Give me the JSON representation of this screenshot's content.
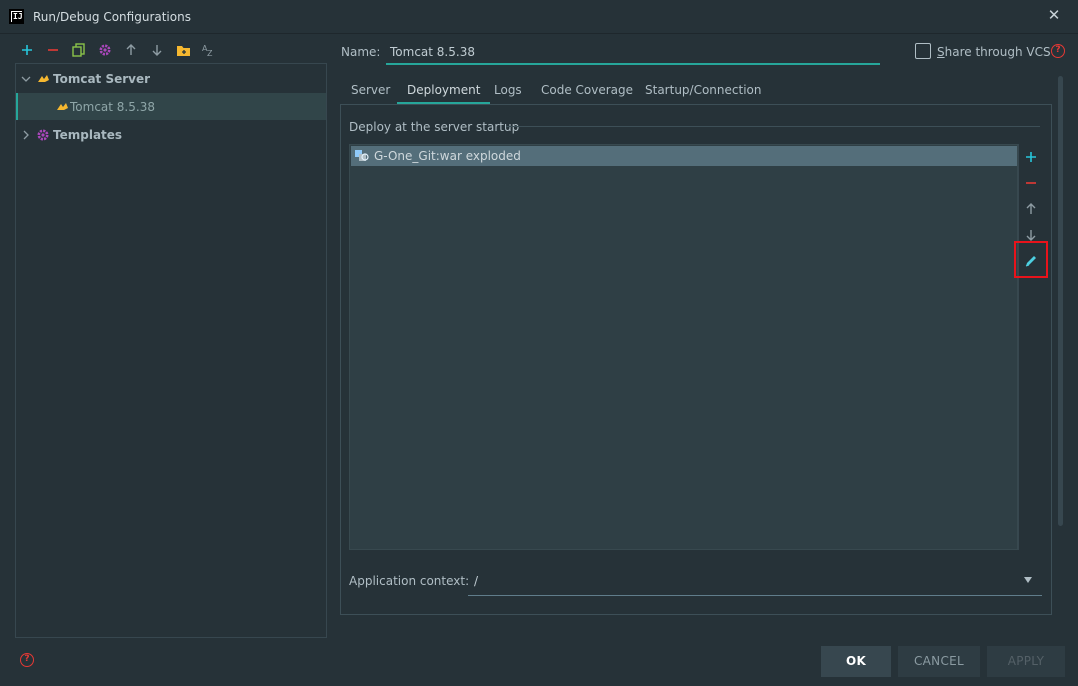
{
  "window": {
    "title": "Run/Debug Configurations",
    "app_icon_text": "IJ"
  },
  "left_toolbar": {
    "icons": [
      "add-icon",
      "remove-icon",
      "copy-icon",
      "settings-icon",
      "move-up-icon",
      "move-down-icon",
      "new-folder-icon",
      "sort-alpha-icon"
    ]
  },
  "tree": {
    "items": [
      {
        "label": "Tomcat Server",
        "expanded": true,
        "icon": "tomcat-icon"
      },
      {
        "label": "Tomcat 8.5.38",
        "selected": true,
        "icon": "tomcat-icon"
      },
      {
        "label": "Templates",
        "expanded": false,
        "icon": "gear-icon"
      }
    ]
  },
  "config": {
    "name_label": "Name:",
    "name_value": "Tomcat 8.5.38",
    "share_prefix": "S",
    "share_rest": "hare through VCS",
    "share_checked": false
  },
  "tabs": [
    {
      "label": "Server",
      "active": false
    },
    {
      "label": "Deployment",
      "active": true
    },
    {
      "label": "Logs",
      "active": false
    },
    {
      "label": "Code Coverage",
      "active": false
    },
    {
      "label": "Startup/Connection",
      "active": false
    }
  ],
  "deployment": {
    "section_title": "Deploy at the server startup",
    "artifacts": [
      {
        "label": "G-One_Git:war exploded",
        "selected": true
      }
    ],
    "side_tools": [
      "add-icon",
      "remove-icon",
      "move-up-icon",
      "move-down-icon",
      "edit-icon"
    ],
    "context_label": "Application context:",
    "context_value": "/"
  },
  "buttons": {
    "ok": "OK",
    "cancel": "CANCEL",
    "apply": "APPLY"
  },
  "colors": {
    "accent": "#26a69a",
    "danger": "#e53935",
    "background": "#263238",
    "highlight": "#e8131b"
  }
}
